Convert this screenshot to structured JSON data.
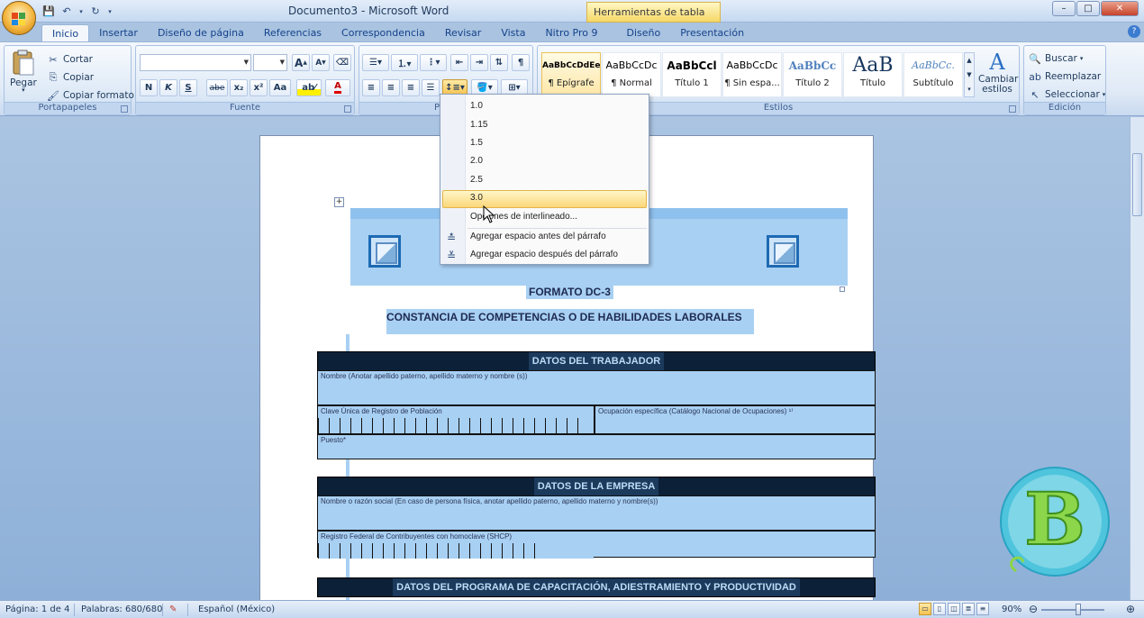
{
  "window": {
    "title": "Documento3 - Microsoft Word",
    "contextual_title": "Herramientas de tabla",
    "controls": [
      "–",
      "□",
      "✕"
    ]
  },
  "tabs": [
    {
      "label": "Inicio",
      "active": true
    },
    {
      "label": "Insertar"
    },
    {
      "label": "Diseño de página"
    },
    {
      "label": "Referencias"
    },
    {
      "label": "Correspondencia"
    },
    {
      "label": "Revisar"
    },
    {
      "label": "Vista"
    },
    {
      "label": "Nitro Pro 9"
    },
    {
      "label": "Diseño"
    },
    {
      "label": "Presentación"
    }
  ],
  "ribbon": {
    "clipboard": {
      "label": "Portapapeles",
      "paste": "Pegar",
      "cut": "Cortar",
      "copy": "Copiar",
      "format_painter": "Copiar formato"
    },
    "font": {
      "label": "Fuente",
      "font_name": "",
      "font_size": "",
      "bold": "N",
      "italic": "K",
      "underline": "S",
      "strike": "abe",
      "subscript": "x₂",
      "superscript": "x²",
      "change_case": "Aa",
      "grow": "A",
      "shrink": "A"
    },
    "paragraph": {
      "label": "Párrafo",
      "label_visible": "Párra"
    },
    "styles": {
      "label": "Estilos",
      "items": [
        {
          "sample": "AaBbCcDdEe",
          "name": "¶ Epígrafe"
        },
        {
          "sample": "AaBbCcDc",
          "name": "¶ Normal"
        },
        {
          "sample": "AaBbCcl",
          "name": "Título 1"
        },
        {
          "sample": "AaBbCcDc",
          "name": "¶ Sin espa..."
        },
        {
          "sample": "AaBbCc",
          "name": "Título 2"
        },
        {
          "sample": "AaB",
          "name": "Título"
        },
        {
          "sample": "AaBbCc.",
          "name": "Subtítulo"
        }
      ],
      "change_styles": "Cambiar estilos"
    },
    "editing": {
      "label": "Edición",
      "find": "Buscar",
      "replace": "Reemplazar",
      "select": "Seleccionar"
    }
  },
  "line_spacing_menu": {
    "options": [
      "1.0",
      "1.15",
      "1.5",
      "2.0",
      "2.5",
      "3.0"
    ],
    "hovered": "3.0",
    "spacing_options": "Opciones de interlineado...",
    "add_before": "Agregar espacio antes del párrafo",
    "add_after": "Agregar espacio después del párrafo"
  },
  "document": {
    "title": "FORMATO DC-3",
    "subtitle": "CONSTANCIA DE COMPETENCIAS O DE HABILIDADES LABORALES",
    "sections": [
      {
        "header": "DATOS DEL TRABAJADOR",
        "fields": [
          "Nombre (Anotar apellido paterno, apellido materno y nombre (s))",
          "Clave Única de Registro de Población",
          "Ocupación específica (Catálogo Nacional de Ocupaciones) ¹⁾",
          "Puesto*"
        ]
      },
      {
        "header": "DATOS DE LA EMPRESA",
        "fields": [
          "Nombre o razón social (En caso de persona física, anotar apellido paterno, apellido materno y nombre(s))",
          "Registro Federal de Contribuyentes con homoclave (SHCP)"
        ]
      },
      {
        "header": "DATOS DEL PROGRAMA DE CAPACITACIÓN, ADIESTRAMIENTO Y PRODUCTIVIDAD",
        "fields": []
      }
    ]
  },
  "statusbar": {
    "page": "Página: 1 de 4",
    "words": "Palabras: 680/680",
    "language": "Español (México)",
    "zoom": "90%"
  },
  "colors": {
    "selection": "#a8d0f3",
    "section_bar": "#0c2038",
    "hover": "#fbd779"
  }
}
